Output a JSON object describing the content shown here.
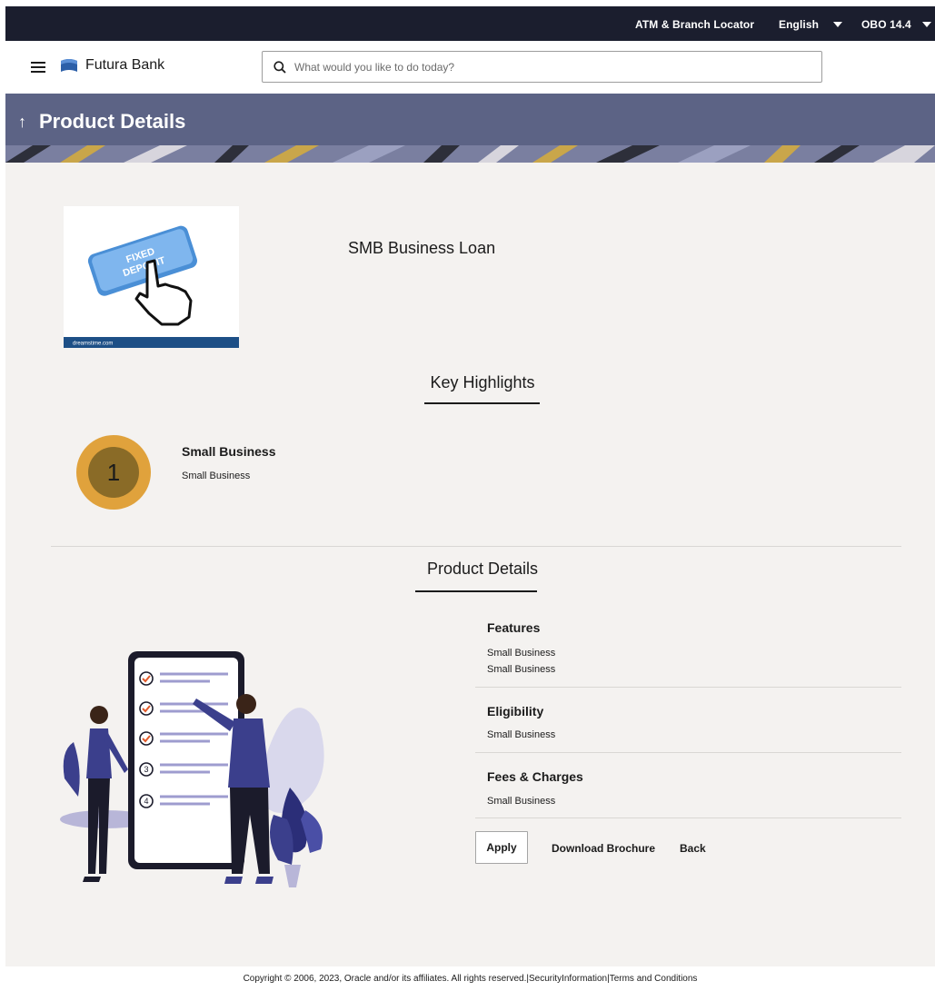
{
  "topbar": {
    "atm_locator": "ATM & Branch Locator",
    "language": "English",
    "user": "OBO 14.4"
  },
  "header": {
    "brand": "Futura Bank",
    "search_placeholder": "What would you like to do today?"
  },
  "banner": {
    "title": "Product Details"
  },
  "product": {
    "name": "SMB Business Loan",
    "image_caption": "FIXED DEPOSIT",
    "image_watermark": "dreamstime.com"
  },
  "key_highlights": {
    "title": "Key Highlights",
    "items": [
      {
        "number": "1",
        "title": "Small Business",
        "description": "Small Business"
      }
    ]
  },
  "product_details": {
    "title": "Product Details",
    "features": {
      "heading": "Features",
      "line1": "Small Business",
      "line2": "Small Business"
    },
    "eligibility": {
      "heading": "Eligibility",
      "text": "Small Business"
    },
    "fees": {
      "heading": "Fees & Charges",
      "text": "Small Business"
    }
  },
  "actions": {
    "apply": "Apply",
    "download": "Download Brochure",
    "back": "Back"
  },
  "footer": {
    "text": "Copyright © 2006, 2023, Oracle and/or its affiliates. All rights reserved.|SecurityInformation|Terms and Conditions"
  },
  "colors": {
    "topbar": "#1b1e2e",
    "banner": "#5c6385",
    "page_bg": "#f4f2f0",
    "badge_outer": "#e0a23c",
    "badge_inner": "#8a6b27",
    "illustration_primary": "#3b3f8c"
  }
}
